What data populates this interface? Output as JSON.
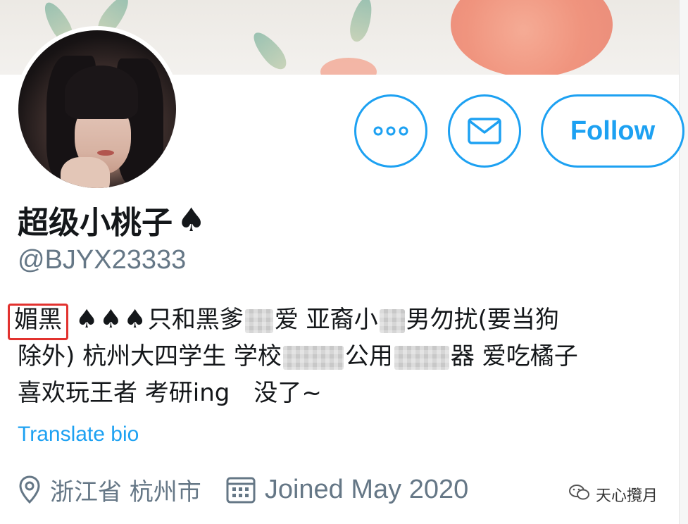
{
  "profile": {
    "display_name": "超级小桃子",
    "name_emoji": "♠",
    "handle": "@BJYX23333"
  },
  "actions": {
    "more_label": "•••",
    "follow_label": "Follow"
  },
  "bio": {
    "highlighted_word": "媚黑",
    "spades": "♠♠♠",
    "line1_a": "只和黑爹",
    "line1_b": "爱 亚裔小",
    "line1_c": "男勿扰(要当狗",
    "line2_a": "除外) 杭州大四学生 学校",
    "line2_b": "公用",
    "line2_c": "器 爱吃橘子",
    "line3": "喜欢玩王者 考研ing　没了~",
    "translate_label": "Translate bio"
  },
  "meta": {
    "location": "浙江省 杭州市",
    "joined": "Joined May 2020"
  },
  "watermark": {
    "text": "天心攬月"
  },
  "colors": {
    "accent": "#1da1f2",
    "secondary_text": "#657786",
    "highlight_box": "#e2322f"
  },
  "icons": [
    "more-dots-icon",
    "mail-icon",
    "location-pin-icon",
    "calendar-icon",
    "wechat-icon"
  ]
}
